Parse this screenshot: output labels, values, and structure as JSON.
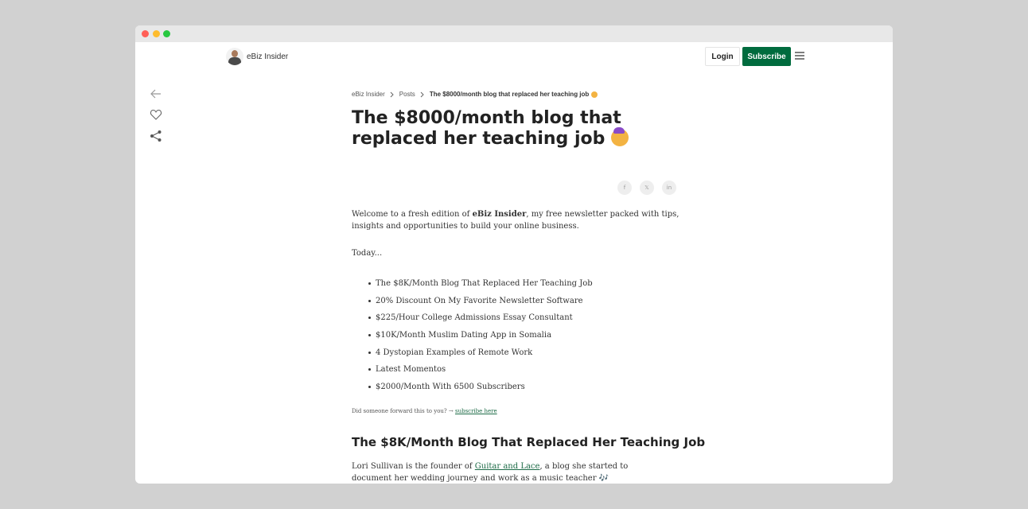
{
  "site": {
    "name": "eBiz Insider"
  },
  "nav": {
    "login_label": "Login",
    "subscribe_label": "Subscribe"
  },
  "breadcrumb": {
    "items": [
      "eBiz Insider",
      "Posts"
    ],
    "current": "The $8000/month blog that replaced her teaching job"
  },
  "article": {
    "title": "The $8000/month blog that replaced her teaching job",
    "share": {
      "facebook": "f",
      "x": "𝕏",
      "linkedin": "in"
    },
    "intro_before": "Welcome to a fresh edition of ",
    "intro_bold": "eBiz Insider",
    "intro_after": ", my free newsletter packed with tips, insights and opportunities to build your online business.",
    "today": "Today...",
    "toc": [
      "The $8K/Month Blog That Replaced Her Teaching Job",
      "20% Discount On My Favorite Newsletter Software",
      "$225/Hour College Admissions Essay Consultant",
      "$10K/Month Muslim Dating App in Somalia",
      "4 Dystopian Examples of Remote Work",
      "Latest Momentos",
      "$2000/Month With 6500 Subscribers"
    ],
    "forward_text": "Did someone forward this to you? → ",
    "forward_link": "subscribe here",
    "section_heading": "The $8K/Month Blog That Replaced Her Teaching Job",
    "para_before": "Lori Sullivan is the founder of ",
    "para_link": "Guitar and Lace",
    "para_after": ", a blog she started to document her wedding journey and work as a music teacher",
    "para_emoji": "🎶"
  },
  "icons": {
    "back": "arrow-left-icon",
    "like": "heart-icon",
    "share": "share-icon",
    "menu": "hamburger-menu-icon"
  },
  "colors": {
    "brand_green": "#006b3e",
    "link_green": "#1d6b47"
  }
}
